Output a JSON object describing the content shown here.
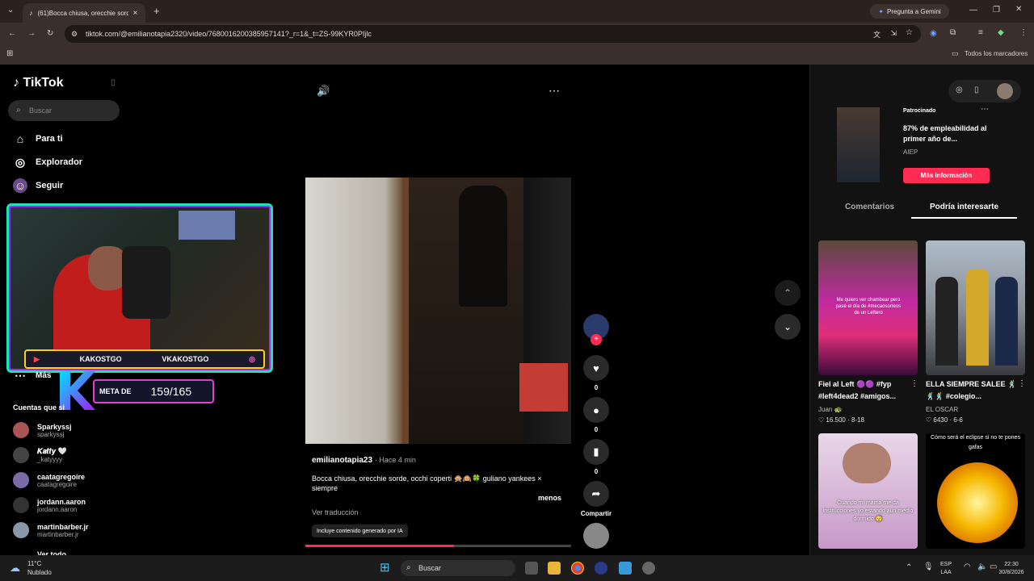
{
  "browser": {
    "tab_title": "(61)Bocca chiusa, orecchie sord...",
    "new_tab": "+",
    "gemini": "Pregunta a Gemini",
    "url": "tiktok.com/@emilianotapia2320/video/7680016200385957141?_r=1&_t=ZS-99KYR0PIjlc",
    "bookmarks_all": "Todos los marcadores"
  },
  "sidebar": {
    "logo": "TikTok",
    "search_placeholder": "Buscar",
    "nav": [
      {
        "label": "Para ti",
        "icon": "home-icon"
      },
      {
        "label": "Explorador",
        "icon": "compass-icon"
      },
      {
        "label": "Seguir",
        "icon": "following-icon"
      }
    ],
    "more": "Más",
    "following_header": "Cuentas que si",
    "accounts": [
      {
        "name": "Sparkyssj",
        "handle": "sparkyssj"
      },
      {
        "name": "𝑲𝒂𝒕𝒕𝒚 🤍",
        "handle": "_katyyyy"
      },
      {
        "name": "caatagregoire",
        "handle": "caatagregoire"
      },
      {
        "name": "jordann.aaron",
        "handle": "jordann.aaron"
      },
      {
        "name": "martinbarber.jr",
        "handle": "martinbarber.jr"
      }
    ],
    "see_all": "Ver todo"
  },
  "stream_overlay": {
    "left_name": "KAKOSTGO",
    "right_name": "VKAKOSTGO",
    "goal_label": "META DE",
    "goal_count": "159/165"
  },
  "video": {
    "username": "emilianotapia23",
    "time_ago": "· Hace 4 min",
    "caption": "Bocca chiusa, orecchie sorde, occhi coperti 🙊🙉🍀 guliano yankees × siempre",
    "less": "menos",
    "translate": "Ver traducción",
    "ai_tag": "Incluye contenido generado por IA",
    "progress": 0.56
  },
  "actions": {
    "likes": "0",
    "comments": "0",
    "saves": "0",
    "share": "Compartir"
  },
  "right": {
    "ad_label": "Patrocinado",
    "ad_title": "87% de empleabilidad al primer año de...",
    "ad_source": "AIEP",
    "ad_button": "Más información",
    "tab_comments": "Comentarios",
    "tab_interest": "Podría interesarte",
    "thumbs": [
      {
        "title": "Fiel al Left 🟣🟣 #fyp #left4dead2 #amigos...",
        "author": "Juan 🐢",
        "stats": "♡ 16.500 · 8-18",
        "overlay": "Me quiero ver chambear pero pasé el día de #mecaosorteos de un Leftero"
      },
      {
        "title": "ELLA SIEMPRE SALEE 🕺🕺🕺 #colegio...",
        "author": "EL OSCAR",
        "stats": "♡ 6430 · 6-6",
        "overlay": ""
      },
      {
        "title": "",
        "author": "",
        "stats": "",
        "overlay": "Cuando mi mamá me da instrucciones yo estando aun medio dormido 😴"
      },
      {
        "title": "",
        "author": "",
        "stats": "",
        "overlay": "Cómo será el eclipse si no te pones gafas"
      }
    ]
  },
  "taskbar": {
    "weather_temp": "11°C",
    "weather_desc": "Nublado",
    "search": "Buscar",
    "lang": "ESP",
    "lang2": "LAA",
    "time": "22:30",
    "date": "30/8/2026"
  }
}
